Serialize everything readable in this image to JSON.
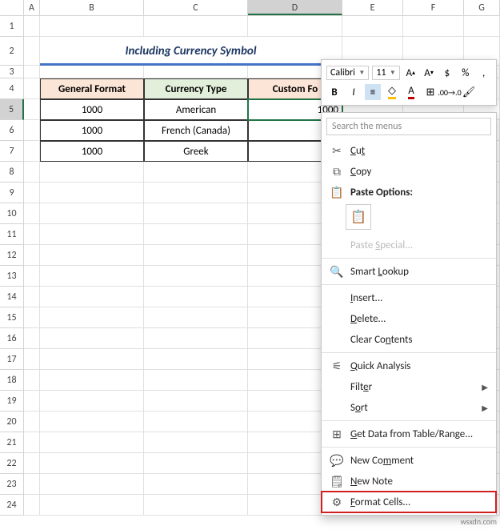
{
  "columns": [
    "A",
    "B",
    "C",
    "D",
    "E",
    "F",
    "G"
  ],
  "title": "Including Currency Symbol",
  "table": {
    "headers": [
      "General Format",
      "Currency Type",
      "Custom Fo"
    ],
    "rows": [
      {
        "gen": "1000",
        "type": "American",
        "custom": "1000"
      },
      {
        "gen": "1000",
        "type": "French (Canada)",
        "custom": ""
      },
      {
        "gen": "1000",
        "type": "Greek",
        "custom": ""
      }
    ]
  },
  "mini": {
    "font": "Calibri",
    "size": "11"
  },
  "search_placeholder": "Search the menus",
  "menu": {
    "cut": "Cut",
    "copy": "Copy",
    "paste_opts": "Paste Options:",
    "paste_special": "Paste Special...",
    "smart": "Smart Lookup",
    "insert": "Insert...",
    "delete": "Delete...",
    "clear": "Clear Contents",
    "quick": "Quick Analysis",
    "filter": "Filter",
    "sort": "Sort",
    "getdata": "Get Data from Table/Range...",
    "comment": "New Comment",
    "note": "New Note",
    "format": "Format Cells..."
  },
  "chart_data": {
    "type": "table",
    "title": "Including Currency Symbol",
    "columns": [
      "General Format",
      "Currency Type",
      "Custom Format"
    ],
    "rows": [
      [
        1000,
        "American",
        1000
      ],
      [
        1000,
        "French (Canada)",
        null
      ],
      [
        1000,
        "Greek",
        null
      ]
    ]
  },
  "watermark": "wsxdn.com"
}
